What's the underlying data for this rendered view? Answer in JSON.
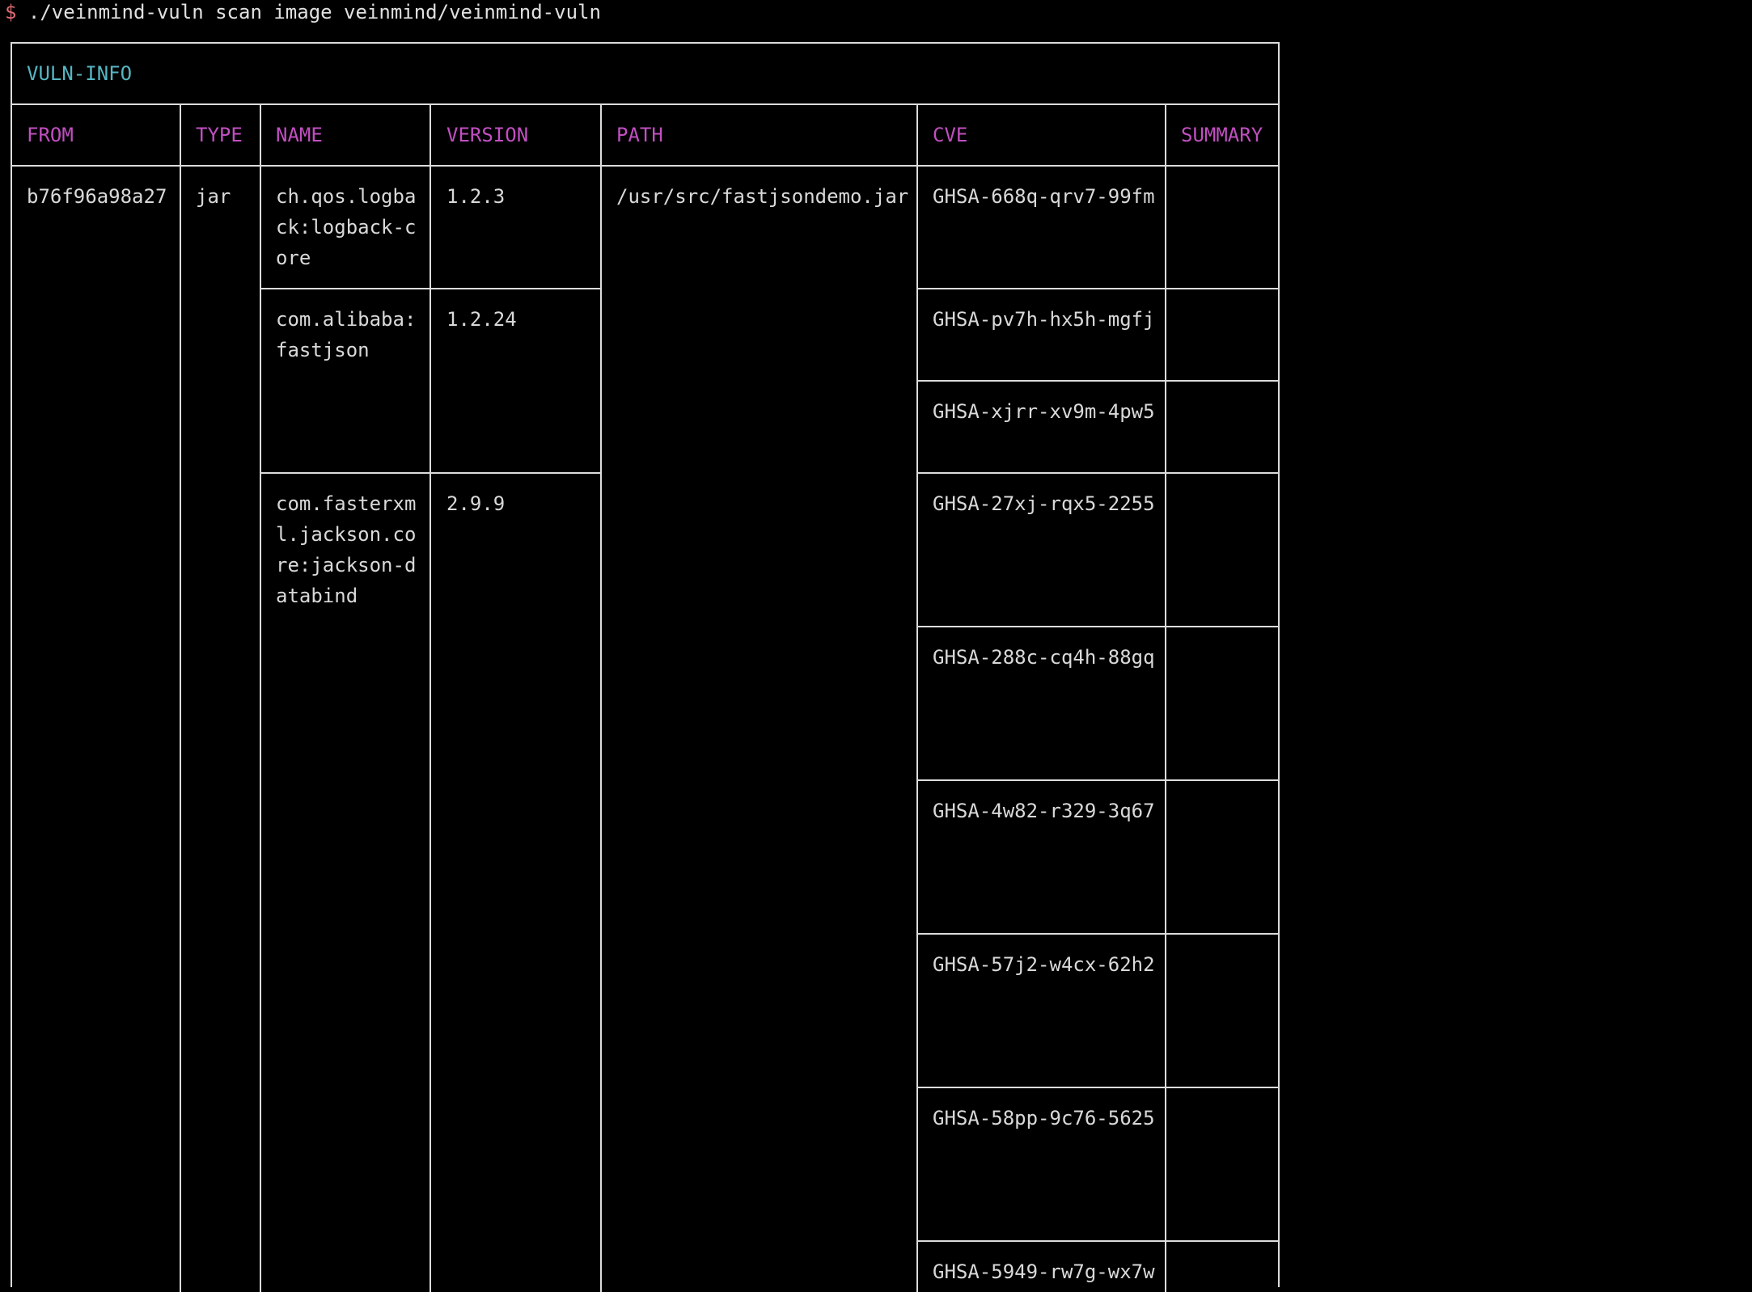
{
  "terminal": {
    "prompt": "$",
    "command": "./veinmind-vuln scan image veinmind/veinmind-vuln"
  },
  "table": {
    "title": "VULN-INFO",
    "columns": [
      "FROM",
      "TYPE",
      "NAME",
      "VERSION",
      "PATH",
      "CVE",
      "SUMMARY"
    ],
    "from": "b76f96a98a27",
    "type": "jar",
    "path": "/usr/src/fastjsondemo.jar",
    "packages": [
      {
        "name_lines": [
          "ch.qos.logba",
          "ck:logback-c",
          "ore"
        ],
        "version": "1.2.3"
      },
      {
        "name_lines": [
          "com.alibaba:",
          "fastjson"
        ],
        "version": "1.2.24"
      },
      {
        "name_lines": [
          "com.fasterxm",
          "l.jackson.co",
          "re:jackson-d",
          "atabind"
        ],
        "version": "2.9.9"
      }
    ],
    "cves": [
      "GHSA-668q-qrv7-99fm",
      "GHSA-pv7h-hx5h-mgfj",
      "GHSA-xjrr-xv9m-4pw5",
      "GHSA-27xj-rqx5-2255",
      "GHSA-288c-cq4h-88gq",
      "GHSA-4w82-r329-3q67",
      "GHSA-57j2-w4cx-62h2",
      "GHSA-58pp-9c76-5625",
      "GHSA-5949-rw7g-wx7w"
    ]
  },
  "colors": {
    "background": "#000000",
    "text": "#d9d9d9",
    "title": "#56b6c2",
    "header": "#c24fc2",
    "prompt": "#e06c75",
    "border": "#dcdcdc"
  }
}
